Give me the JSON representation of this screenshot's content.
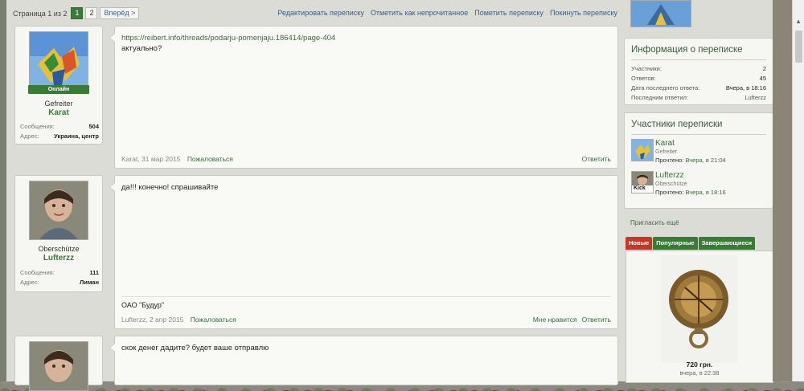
{
  "pager": {
    "label": "Страница 1 из 2",
    "pages": [
      "1",
      "2"
    ],
    "next": "Вперёд >"
  },
  "top_actions": [
    "Редактировать переписку",
    "Отметить как непрочитанное",
    "Пометить переписку",
    "Покинуть переписку"
  ],
  "posts": [
    {
      "online": "Онлайн",
      "rank": "Gefreiter",
      "name": "Karat",
      "stat1_label": "Сообщения:",
      "stat1_value": "504",
      "stat2_label": "Адрес:",
      "stat2_value": "Украина, центр",
      "link": "https://reibert.info/threads/podarju-pomenjaju.186414/page-404",
      "text": "актуально?",
      "meta_author": "Karat, 31 мар 2015",
      "report": "Пожаловаться",
      "action_reply": "Ответить"
    },
    {
      "rank": "Oberschütze",
      "name": "Lufterzz",
      "stat1_label": "Сообщения:",
      "stat1_value": "111",
      "stat2_label": "Адрес:",
      "stat2_value": "Лиман",
      "text": "да!!! конечно! спрашивайте",
      "signature": "ОАО \"Будур\"",
      "meta_author": "Lufterzz, 2 апр 2015",
      "report": "Пожаловаться",
      "action_like": "Мне нравится",
      "action_reply": "Ответить"
    },
    {
      "text": "скок денег дадите? будет ваше отправлю"
    }
  ],
  "info_box": {
    "title": "Информация о переписке",
    "rows": [
      {
        "label": "Участники:",
        "value": "2"
      },
      {
        "label": "Ответов:",
        "value": "45"
      },
      {
        "label": "Дата последнего ответа:",
        "value": "Вчера, в 18:16"
      },
      {
        "label": "Последним ответил:",
        "value": "Lufterzz"
      }
    ]
  },
  "participants_box": {
    "title": "Участники переписки",
    "items": [
      {
        "name": "Karat",
        "rank": "Gefreiter",
        "read_label": "Прочтено:",
        "read_value": "Вчера, в 21:04"
      },
      {
        "name": "Lufterzz",
        "rank": "Oberschütze",
        "read_label": "Прочтено:",
        "read_value": "Вчера, в 18:16",
        "badge": "Kick"
      }
    ]
  },
  "invite": "Пригласить ещё",
  "tabs": [
    "Новые",
    "Популярные",
    "Завершающиеся"
  ],
  "ad": {
    "price": "720 грн.",
    "date": "вчера, в 22:38"
  }
}
